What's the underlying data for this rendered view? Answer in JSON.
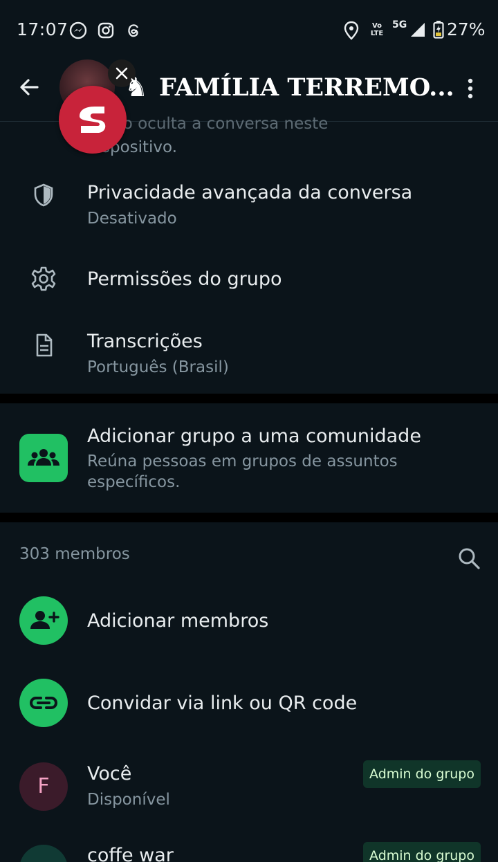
{
  "status_bar": {
    "time": "17:07",
    "battery_percent": "27%",
    "network": "5G",
    "volte": "Vo LTE",
    "icons": [
      "messenger-icon",
      "instagram-icon",
      "threads-icon",
      "location-icon",
      "signal-icon",
      "battery-icon"
    ]
  },
  "header": {
    "title": "FAMÍLIA TERREMO...",
    "title_prefix_icon": "knight-chess-icon"
  },
  "partial_notice": {
    "line1": "… a o oculta a conversa neste",
    "line2": "dispositivo."
  },
  "settings": {
    "privacy": {
      "title": "Privacidade avançada da conversa",
      "subtitle": "Desativado"
    },
    "permissions": {
      "title": "Permissões do grupo"
    },
    "transcriptions": {
      "title": "Transcrições",
      "subtitle": "Português (Brasil)"
    }
  },
  "community": {
    "title": "Adicionar grupo a uma comunidade",
    "subtitle": "Reúna pessoas em grupos de assuntos específicos."
  },
  "members": {
    "count_label": "303 membros",
    "add_label": "Adicionar membros",
    "invite_label": "Convidar via link ou QR code",
    "list": [
      {
        "initial": "F",
        "name": "Você",
        "status": "Disponível",
        "badge": "Admin do grupo"
      },
      {
        "name": "coffe war",
        "badge": "Admin do grupo"
      }
    ]
  },
  "colors": {
    "background": "#0b141a",
    "accent_green": "#21c063",
    "floating_logo": "#c8233a",
    "admin_badge_bg": "#103529"
  }
}
